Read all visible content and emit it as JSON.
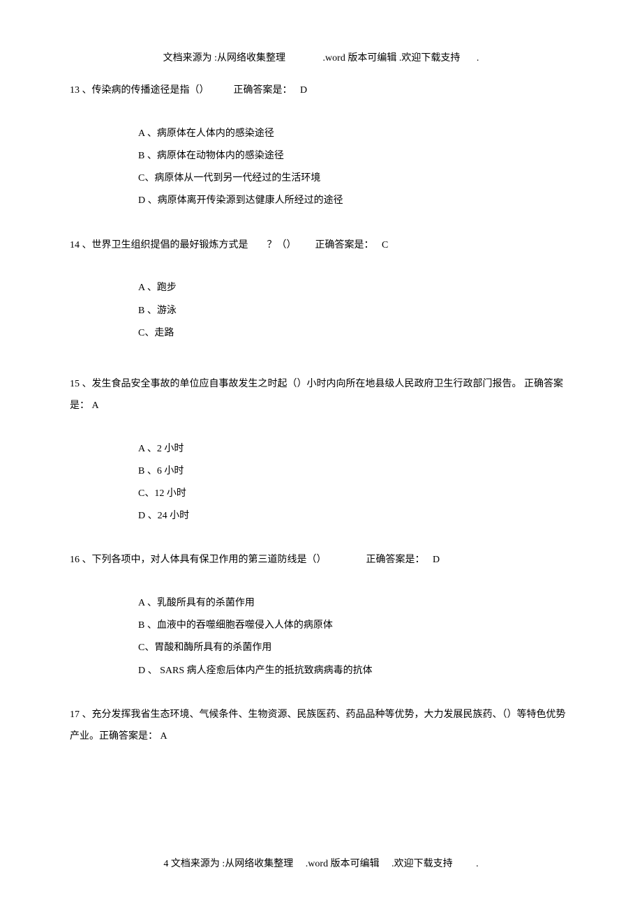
{
  "header": {
    "part1": "文档来源为 :从网络收集整理",
    "part2": ".word 版本可编辑 .欢迎下载支持",
    "part3": "."
  },
  "questions": [
    {
      "num": "13",
      "text": "、传染病的传播途径是指（）",
      "answer_label": "正确答案是：",
      "answer": "D",
      "options": [
        {
          "letter": "A 、",
          "text": "病原体在人体内的感染途径"
        },
        {
          "letter": "B 、",
          "text": "病原体在动物体内的感染途径"
        },
        {
          "letter": "C、",
          "text": "病原体从一代到另一代经过的生活环境"
        },
        {
          "letter": "D 、",
          "text": "病原体离开传染源到达健康人所经过的途径"
        }
      ]
    },
    {
      "num": "14",
      "text": "、世界卫生组织提倡的最好锻炼方式是",
      "text2": "？（）",
      "answer_label": "正确答案是：",
      "answer": "C",
      "options": [
        {
          "letter": "A 、",
          "text": "跑步"
        },
        {
          "letter": "B 、",
          "text": "游泳"
        },
        {
          "letter": "C、",
          "text": "走路"
        }
      ]
    },
    {
      "num": "15",
      "text": "、发生食品安全事故的单位应自事故发生之时起（）小时内向所在地县级人民政府卫生行政部门报告。",
      "answer_label": " 正确答案是：",
      "answer": "A",
      "options": [
        {
          "letter": "A 、",
          "text": "2 小时"
        },
        {
          "letter": "B 、",
          "text": "6 小时"
        },
        {
          "letter": "C、",
          "text": "12 小时"
        },
        {
          "letter": "D 、",
          "text": "24 小时"
        }
      ]
    },
    {
      "num": "16",
      "text": "、下列各项中，对人体具有保卫作用的第三道防线是（）",
      "answer_label": "正确答案是：",
      "answer": "D",
      "options": [
        {
          "letter": "A 、",
          "text": "乳酸所具有的杀菌作用"
        },
        {
          "letter": "B 、",
          "text": "血液中的吞噬细胞吞噬侵入人体的病原体"
        },
        {
          "letter": "C、",
          "text": "胃酸和酶所具有的杀菌作用"
        },
        {
          "letter": "D 、 ",
          "text": "SARS 病人痊愈后体内产生的抵抗致病病毒的抗体"
        }
      ]
    },
    {
      "num": "17",
      "text": "、充分发挥我省生态环境、气候条件、生物资源、民族医药、药品品种等优势，大力发展民族药、（）等特色优势产业。正确答案是：",
      "answer_label": "",
      "answer": " A",
      "options": []
    }
  ],
  "footer": {
    "page": "4",
    "ft1": " 文档来源为 :从网络收集整理",
    "ft2": ".word 版本可编辑",
    "ft3": ".欢迎下载支持",
    "ft4": "."
  }
}
